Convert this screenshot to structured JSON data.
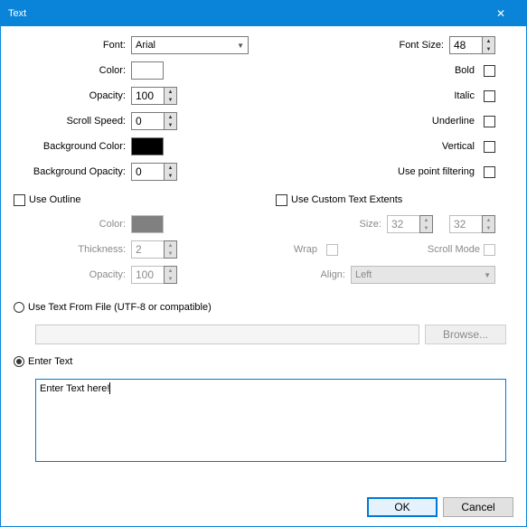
{
  "title": "Text",
  "left": {
    "font_label": "Font:",
    "font_value": "Arial",
    "color_label": "Color:",
    "color_value": "#ffffff",
    "opacity_label": "Opacity:",
    "opacity_value": "100",
    "scroll_label": "Scroll Speed:",
    "scroll_value": "0",
    "bgcolor_label": "Background Color:",
    "bgcolor_value": "#000000",
    "bgopacity_label": "Background Opacity:",
    "bgopacity_value": "0"
  },
  "right": {
    "fontsize_label": "Font Size:",
    "fontsize_value": "48",
    "bold_label": "Bold",
    "italic_label": "Italic",
    "underline_label": "Underline",
    "vertical_label": "Vertical",
    "pointfilter_label": "Use point filtering"
  },
  "outline": {
    "use_label": "Use Outline",
    "color_label": "Color:",
    "color_value": "#808080",
    "thickness_label": "Thickness:",
    "thickness_value": "2",
    "opacity_label": "Opacity:",
    "opacity_value": "100"
  },
  "extents": {
    "use_label": "Use Custom Text Extents",
    "size_label": "Size:",
    "size_w": "32",
    "size_h": "32",
    "wrap_label": "Wrap",
    "scrollmode_label": "Scroll Mode",
    "align_label": "Align:",
    "align_value": "Left"
  },
  "file": {
    "radio_label": "Use Text From File (UTF-8 or compatible)",
    "browse_label": "Browse..."
  },
  "enter": {
    "radio_label": "Enter Text",
    "text_value": "Enter Text here!"
  },
  "buttons": {
    "ok": "OK",
    "cancel": "Cancel"
  }
}
